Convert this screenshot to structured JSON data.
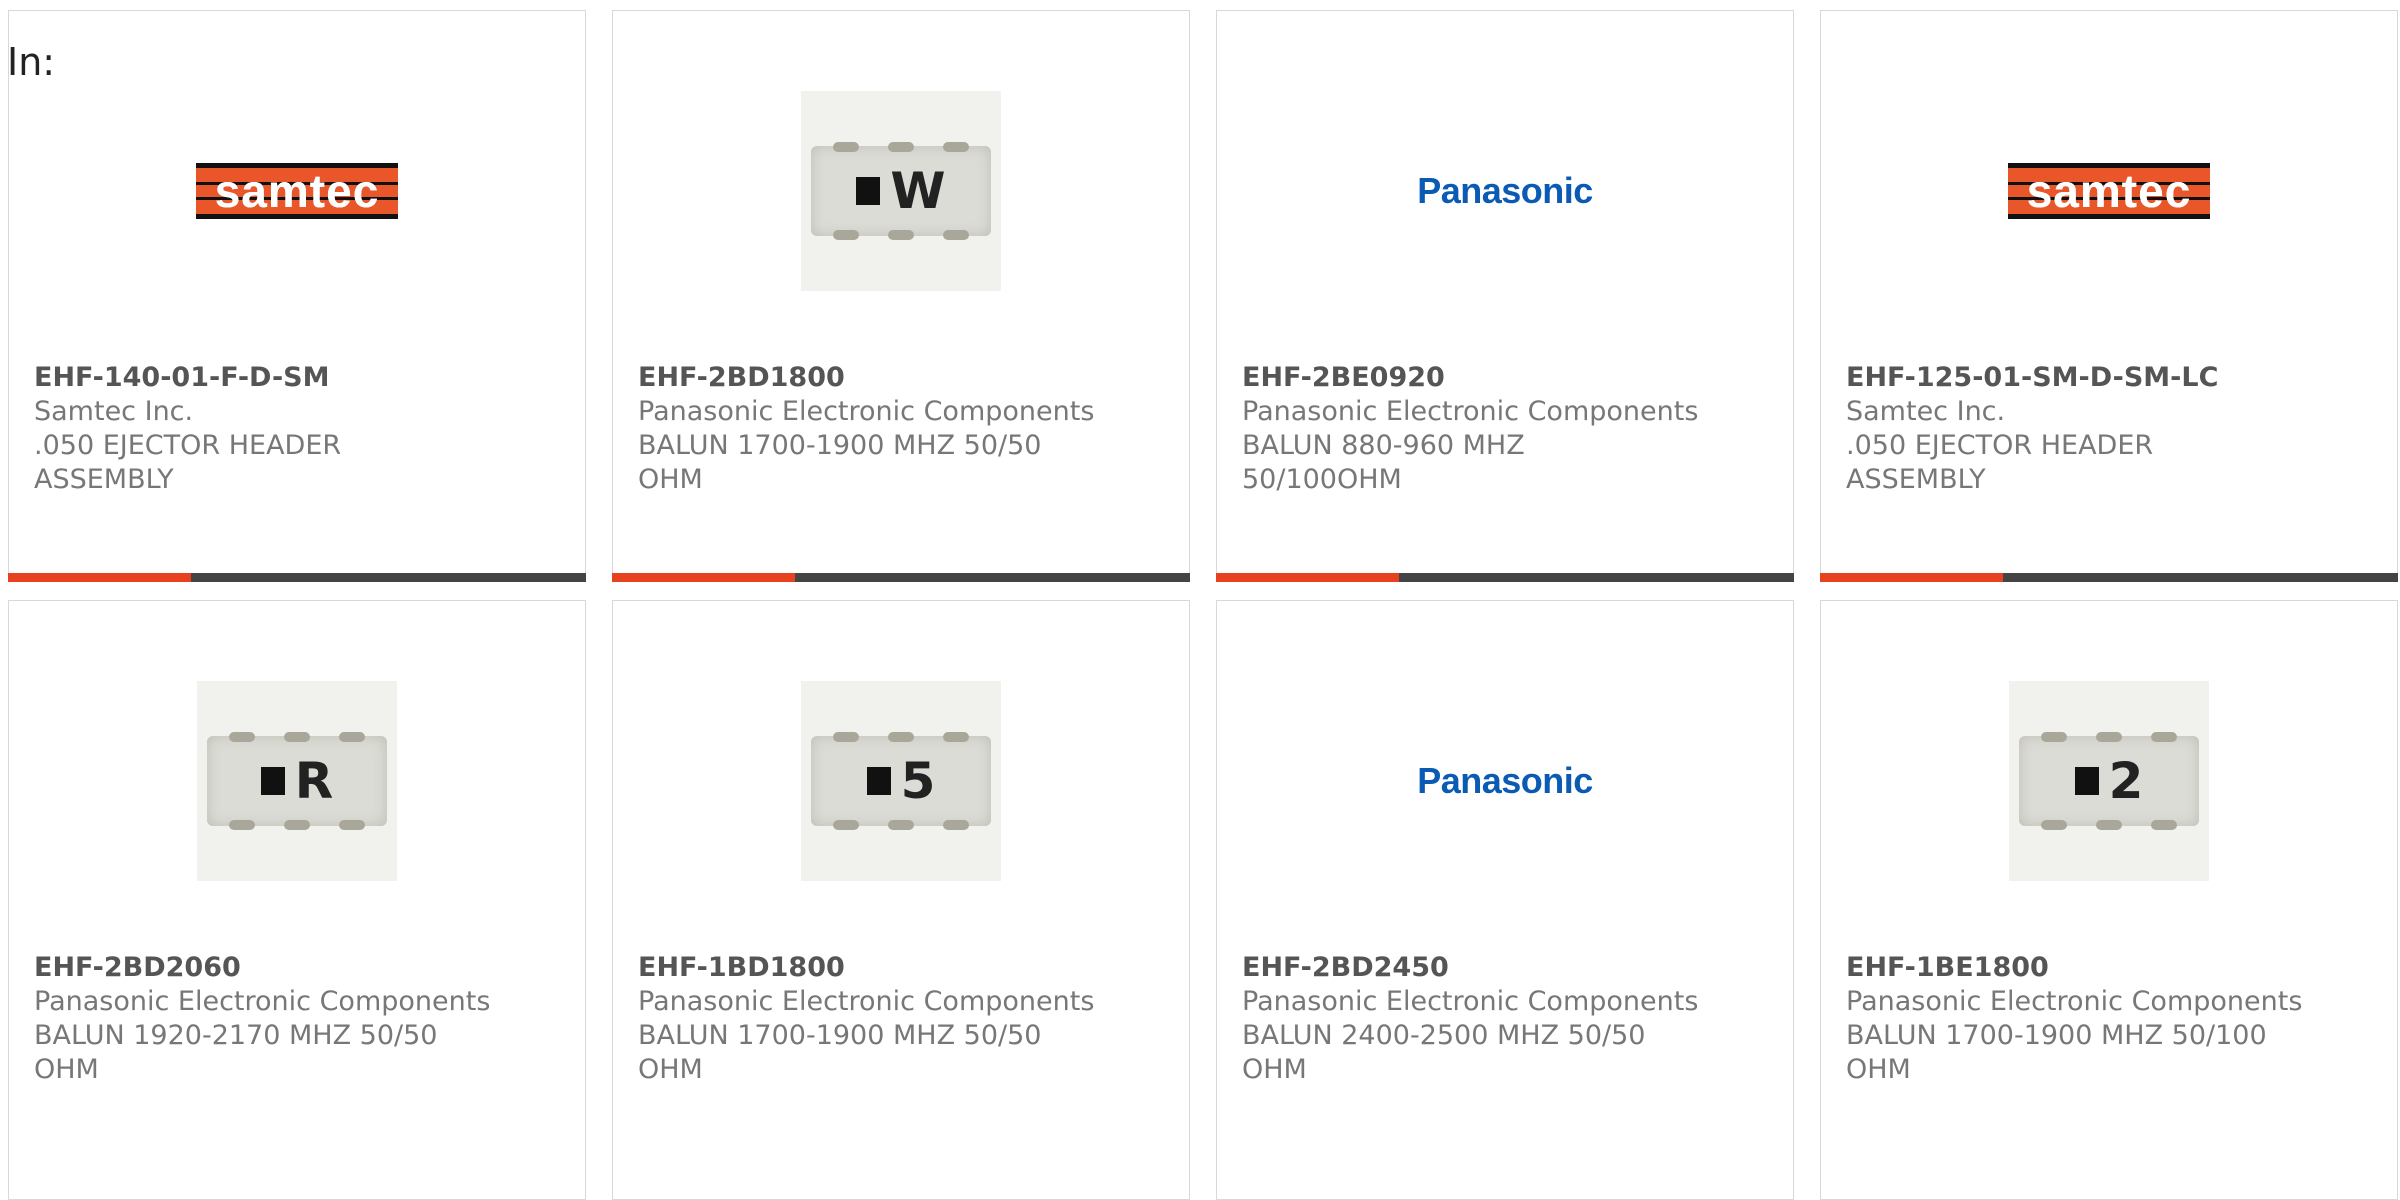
{
  "header": {
    "in_label": "In:"
  },
  "cards": [
    {
      "part": "EHF-140-01-F-D-SM",
      "manufacturer": "Samtec Inc.",
      "description": ".050 EJECTOR HEADER ASSEMBLY",
      "image": "samtec-logo"
    },
    {
      "part": "EHF-2BD1800",
      "manufacturer": "Panasonic Electronic Components",
      "description": "BALUN 1700-1900 MHZ 50/50 OHM",
      "image": "chip",
      "chip_char": "W"
    },
    {
      "part": "EHF-2BE0920",
      "manufacturer": "Panasonic Electronic Components",
      "description": "BALUN 880-960 MHZ 50/100OHM",
      "image": "panasonic-logo"
    },
    {
      "part": "EHF-125-01-SM-D-SM-LC",
      "manufacturer": "Samtec Inc.",
      "description": ".050 EJECTOR HEADER ASSEMBLY",
      "image": "samtec-logo"
    },
    {
      "part": "EHF-2BD2060",
      "manufacturer": "Panasonic Electronic Components",
      "description": "BALUN 1920-2170 MHZ 50/50 OHM",
      "image": "chip",
      "chip_char": "R"
    },
    {
      "part": "EHF-1BD1800",
      "manufacturer": "Panasonic Electronic Components",
      "description": "BALUN 1700-1900 MHZ 50/50 OHM",
      "image": "chip",
      "chip_char": "5"
    },
    {
      "part": "EHF-2BD2450",
      "manufacturer": "Panasonic Electronic Components",
      "description": "BALUN 2400-2500 MHZ 50/50 OHM",
      "image": "panasonic-logo"
    },
    {
      "part": "EHF-1BE1800",
      "manufacturer": "Panasonic Electronic Components",
      "description": "BALUN 1700-1900 MHZ 50/100 OHM",
      "image": "chip",
      "chip_char": "2"
    }
  ],
  "logos": {
    "samtec": "samtec",
    "panasonic": "Panasonic"
  },
  "colors": {
    "accent": "#e8411f",
    "bar": "#444444",
    "panasonic_blue": "#0b5bb5",
    "samtec_orange": "#e9562a"
  }
}
